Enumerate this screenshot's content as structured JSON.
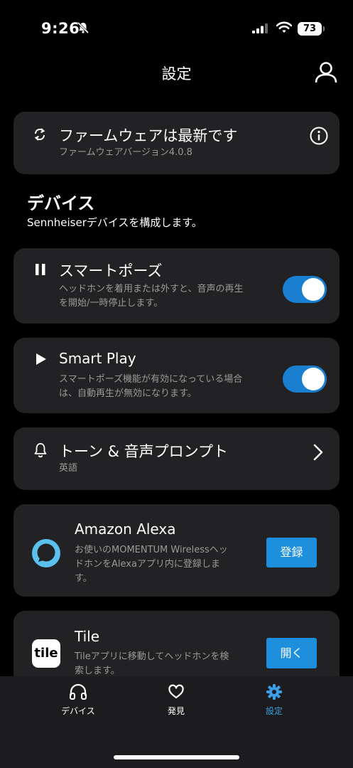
{
  "status_bar": {
    "time": "9:26",
    "battery": "73"
  },
  "header": {
    "title": "設定"
  },
  "firmware": {
    "title": "ファームウェアは最新です",
    "subtitle": "ファームウェアバージョン4.0.8"
  },
  "devices_section": {
    "title": "デバイス",
    "subtitle": "Sennheiserデバイスを構成します。"
  },
  "smart_pause": {
    "title": "スマートポーズ",
    "description_line1": "ヘッドホンを着用または外すと、音声の再生",
    "description_line2": "を開始/一時停止します。",
    "enabled": true
  },
  "smart_play": {
    "title": "Smart Play",
    "description_line1": "スマートポーズ機能が有効になっている場合",
    "description_line2": "は、自動再生が無効になります。",
    "enabled": true
  },
  "tones": {
    "title": "トーン & 音声プロンプト",
    "value": "英語"
  },
  "alexa": {
    "title": "Amazon Alexa",
    "description_line1": "お使いのMOMENTUM Wirelessヘッ",
    "description_line2": "ドホンをAlexaアプリ内に登録しま",
    "description_line3": "す。",
    "button": "登録"
  },
  "tile": {
    "title": "Tile",
    "logo_text": "tile",
    "description_line1": "Tileアプリに移動してヘッドホンを検",
    "description_line2": "索します。",
    "button": "開く"
  },
  "tabs": [
    {
      "label": "デバイス",
      "icon": "headphones-icon",
      "active": false
    },
    {
      "label": "発見",
      "icon": "heart-icon",
      "active": false
    },
    {
      "label": "設定",
      "icon": "gear-icon",
      "active": true
    }
  ],
  "colors": {
    "accent": "#1d8fdc",
    "card": "#222224",
    "background": "#000000"
  }
}
